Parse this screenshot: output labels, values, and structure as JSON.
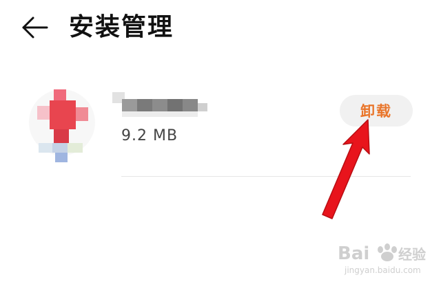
{
  "header": {
    "back_icon": "arrow-left-icon",
    "title": "安装管理"
  },
  "app": {
    "name": "",
    "size": "9.2 MB",
    "uninstall_label": "卸载"
  },
  "annotation": {
    "arrow_icon": "red-arrow-icon",
    "arrow_color": "#e8141c"
  },
  "watermark": {
    "brand": "Bai",
    "brand_suffix": "经验",
    "url": "jingyan.baidu.com"
  },
  "colors": {
    "accent": "#e9752a",
    "button_bg": "#f1f1f1",
    "divider": "#e6e6e6"
  }
}
